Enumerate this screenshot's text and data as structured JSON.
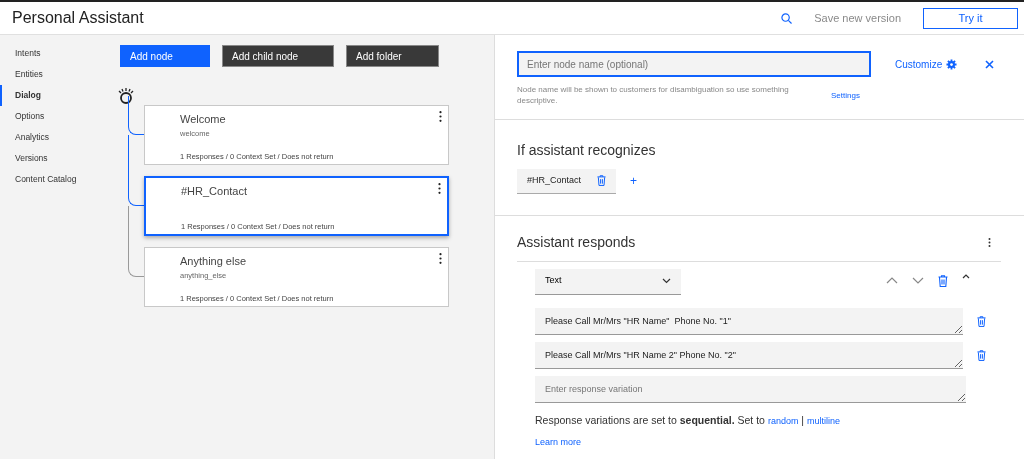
{
  "header": {
    "title": "Personal Assistant",
    "save_label": "Save new version",
    "try_label": "Try it"
  },
  "sidebar": {
    "items": [
      {
        "label": "Intents",
        "selected": false
      },
      {
        "label": "Entities",
        "selected": false
      },
      {
        "label": "Dialog",
        "selected": true
      },
      {
        "label": "Options",
        "selected": false
      },
      {
        "label": "Analytics",
        "selected": false
      },
      {
        "label": "Versions",
        "selected": false
      },
      {
        "label": "Content Catalog",
        "selected": false
      }
    ]
  },
  "toolbar": [
    {
      "label": "Add node",
      "kind": "primary"
    },
    {
      "label": "Add child node",
      "kind": "dark"
    },
    {
      "label": "Add folder",
      "kind": "dark"
    }
  ],
  "nodes": [
    {
      "title": "Welcome",
      "condition": "welcome",
      "summary": "1 Responses / 0 Context Set / Does not return",
      "selected": false
    },
    {
      "title": "#HR_Contact",
      "summary": "1 Responses / 0 Context Set / Does not return",
      "selected": true
    },
    {
      "title": "Anything else",
      "condition": "anything_else",
      "summary": "1 Responses / 0 Context Set / Does not return",
      "selected": false
    }
  ],
  "editor": {
    "name_field": {
      "placeholder": "Enter node name (optional)"
    },
    "customize_label": "Customize",
    "help_text": "Node name will be shown to customers for disambiguation so use something descriptive.",
    "settings_label": "Settings",
    "recognizes": {
      "heading": "If assistant recognizes",
      "conditions": [
        "#HR_Contact"
      ],
      "add_label": "+"
    },
    "responds": {
      "heading": "Assistant responds",
      "response_type": "Text",
      "variations": [
        "Please Call Mr/Mrs \"HR Name\"  Phone No. \"1\"",
        "Please Call Mr/Mrs \"HR Name 2\" Phone No. \"2\""
      ],
      "new_variation": {
        "placeholder": "Enter response variation"
      },
      "mode_text": "Response variations are set to **sequential.** Set to",
      "mode_links": [
        "random",
        "multiline"
      ],
      "mode_separator": "|",
      "learn_more": "Learn more"
    }
  }
}
